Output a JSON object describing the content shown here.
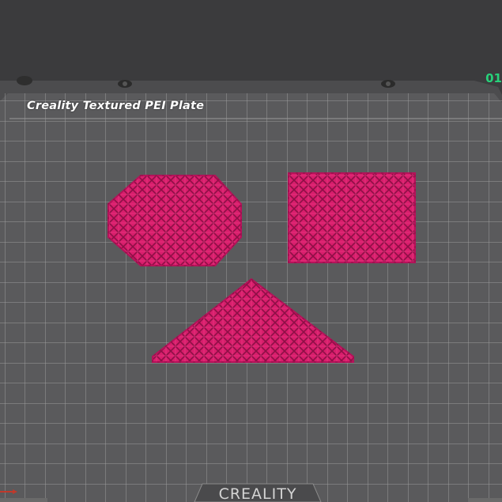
{
  "plate": {
    "name": "Creality Textured PEI Plate",
    "number": "01",
    "brand": "CREALITY"
  },
  "colors": {
    "background": "#3b3b3d",
    "plate_surface": "#5a5a5c",
    "grid_line": "#a8a8a8",
    "model": "#d81e6c",
    "model_dark": "#8e0f46",
    "plate_number": "#27d17a"
  },
  "objects": [
    {
      "shape": "octagon",
      "pattern": "lattice"
    },
    {
      "shape": "square",
      "pattern": "lattice"
    },
    {
      "shape": "triangle",
      "pattern": "lattice"
    }
  ]
}
